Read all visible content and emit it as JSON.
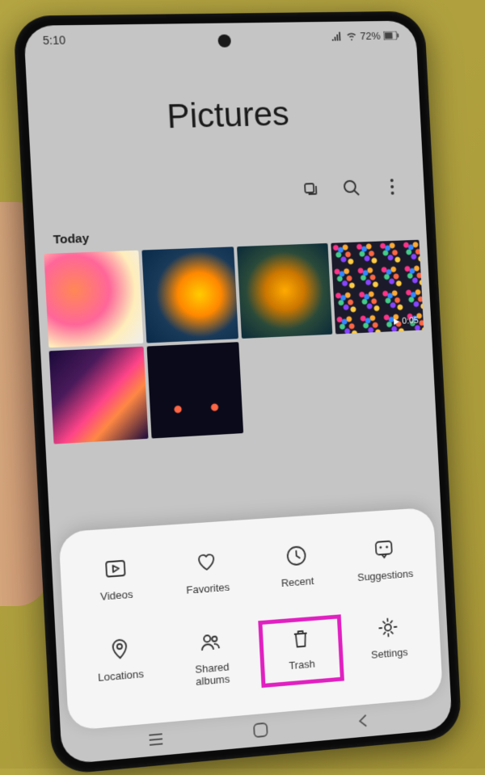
{
  "status_bar": {
    "time": "5:10",
    "battery": "72%"
  },
  "header": {
    "title": "Pictures"
  },
  "section": {
    "label": "Today"
  },
  "video_duration": "0:05",
  "menu": {
    "videos": "Videos",
    "favorites": "Favorites",
    "recent": "Recent",
    "suggestions": "Suggestions",
    "locations": "Locations",
    "shared_albums": "Shared\nalbums",
    "trash": "Trash",
    "settings": "Settings"
  }
}
